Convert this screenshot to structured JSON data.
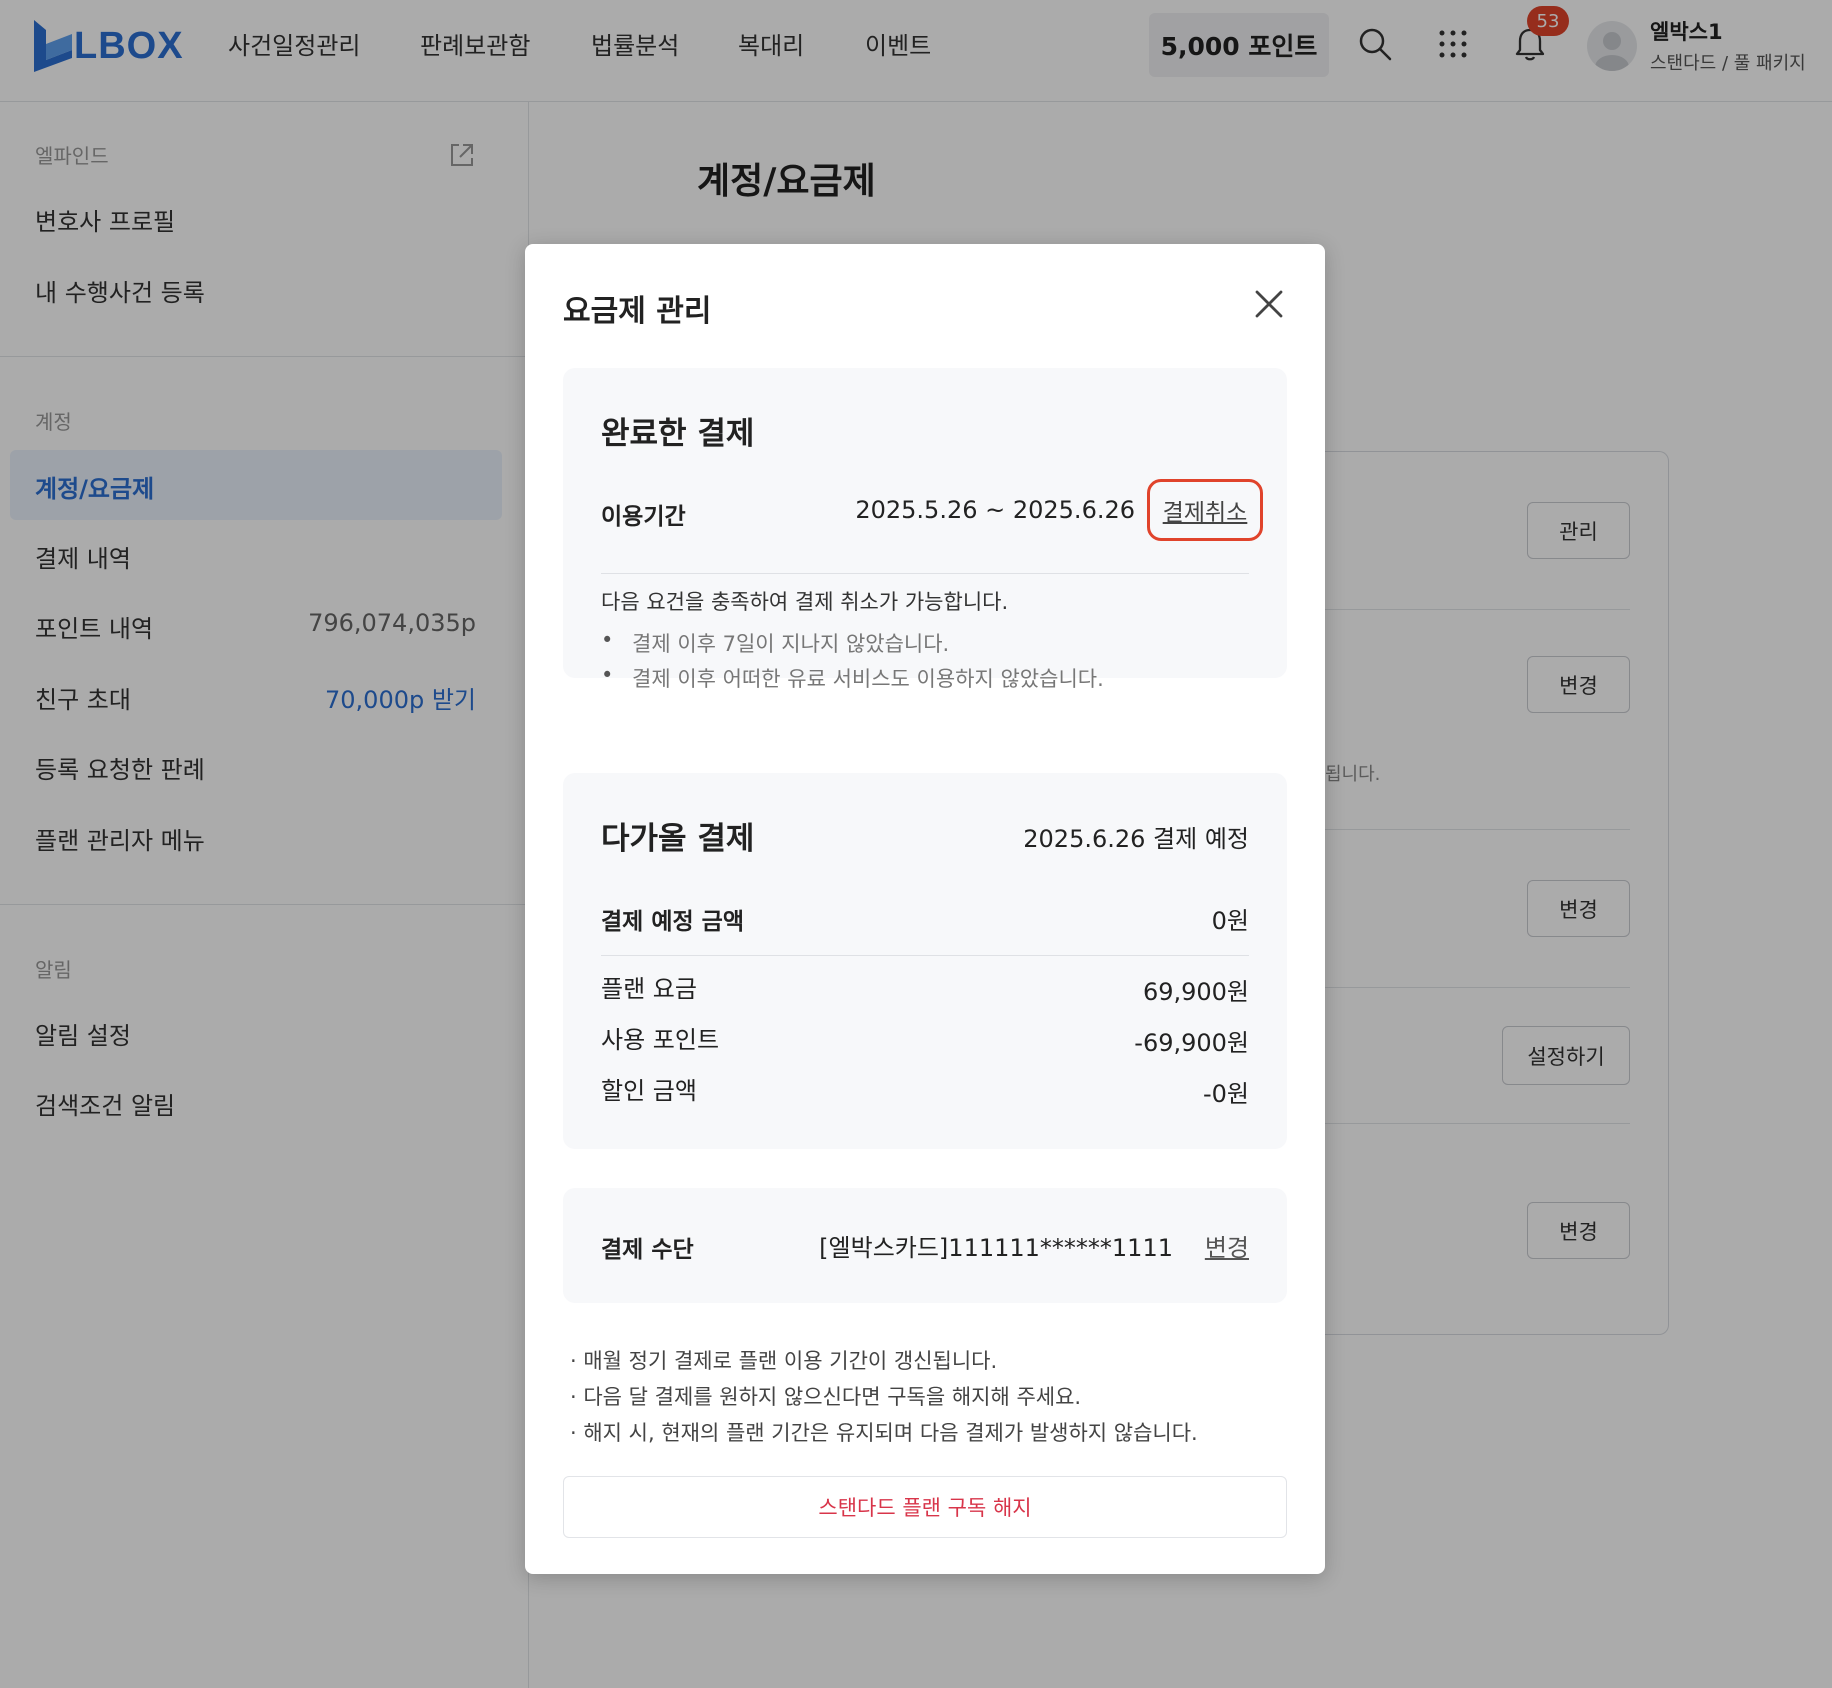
{
  "brand": {
    "logo_text": "LBOX",
    "accent": "#2c6fd1"
  },
  "nav": {
    "items": [
      "사건일정관리",
      "판례보관함",
      "법률분석",
      "복대리",
      "이벤트"
    ],
    "points_label": "5,000 포인트",
    "notification_count": "53",
    "user_name": "엘박스1",
    "user_plan": "스탠다드 / 풀 패키지"
  },
  "sidebar": {
    "section_lfind": "엘파인드",
    "lawyer_profile": "변호사 프로필",
    "register_case": "내 수행사건 등록",
    "section_account": "계정",
    "account_plan": "계정/요금제",
    "payment_history": "결제 내역",
    "point_history": "포인트 내역",
    "point_value": "796,074,035p",
    "invite_friend": "친구 초대",
    "invite_reward": "70,000p 받기",
    "requested_cases": "등록 요청한 판례",
    "plan_admin_menu": "플랜 관리자 메뉴",
    "section_alert": "알림",
    "alert_settings": "알림 설정",
    "search_alert": "검색조건 알림"
  },
  "main": {
    "title": "계정/요금제",
    "buttons": {
      "manage": "관리",
      "change": "변경",
      "setup": "설정하기"
    },
    "partial_text": "됩니다."
  },
  "modal": {
    "title": "요금제 관리",
    "completed": {
      "title": "완료한 결제",
      "period_label": "이용기간",
      "period_value": "2025.5.26 ~ 2025.6.26",
      "cancel_label": "결제취소",
      "condition_intro": "다음 요건을 충족하여 결제 취소가 가능합니다.",
      "conditions": [
        "결제 이후 7일이 지나지 않았습니다.",
        "결제 이후 어떠한 유료 서비스도 이용하지 않았습니다."
      ]
    },
    "upcoming": {
      "title": "다가올 결제",
      "scheduled": "2025.6.26 결제 예정",
      "amount_label": "결제 예정 금액",
      "amount_value": "0원",
      "plan_fee_label": "플랜 요금",
      "plan_fee_value": "69,900원",
      "points_used_label": "사용 포인트",
      "points_used_value": "-69,900원",
      "discount_label": "할인 금액",
      "discount_value": "-0원"
    },
    "payment_method": {
      "label": "결제 수단",
      "value": "[엘박스카드]111111******1111",
      "change_label": "변경"
    },
    "notes": [
      "· 매월 정기 결제로 플랜 이용 기간이 갱신됩니다.",
      "· 다음 달 결제를 원하지 않으신다면 구독을 해지해 주세요.",
      "· 해지 시, 현재의 플랜 기간은 유지되며 다음 결제가 발생하지 않습니다."
    ],
    "unsubscribe_label": "스탠다드 플랜 구독 해지"
  }
}
